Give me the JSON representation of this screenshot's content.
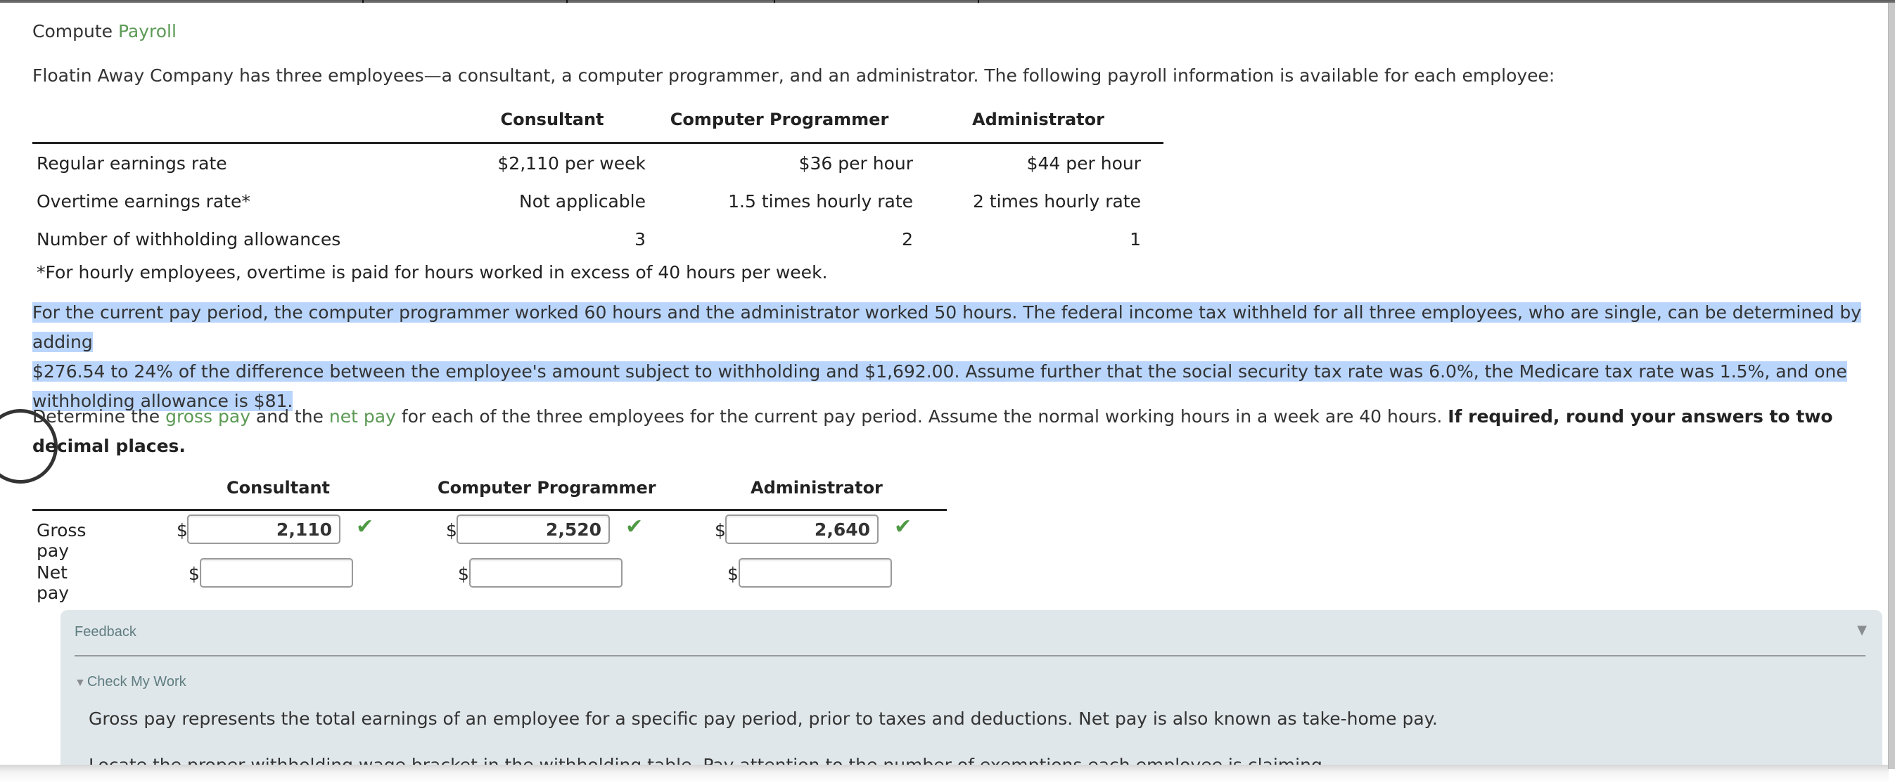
{
  "title": {
    "prefix": "Compute ",
    "link": "Payroll"
  },
  "intro": "Floatin Away Company has three employees—a consultant, a computer programmer, and an administrator. The following payroll information is available for each employee:",
  "info_table": {
    "headers": [
      "",
      "Consultant",
      "Computer Programmer",
      "Administrator"
    ],
    "rows": [
      {
        "label": "Regular earnings rate",
        "values": [
          "$2,110 per week",
          "$36 per hour",
          "$44 per hour"
        ]
      },
      {
        "label": "Overtime earnings rate*",
        "values": [
          "Not applicable",
          "1.5 times hourly rate",
          "2 times hourly rate"
        ]
      },
      {
        "label": "Number of withholding allowances",
        "values": [
          "3",
          "2",
          "1"
        ]
      }
    ],
    "footnote": "*For hourly employees, overtime is paid for hours worked in excess of 40 hours per week."
  },
  "scenario": {
    "line1": "For the current pay period, the computer programmer worked 60 hours and the administrator worked 50 hours. The federal income tax withheld for all three employees, who are single, can be determined by adding",
    "line2": "$276.54 to 24% of the difference between the employee's amount subject to withholding and $1,692.00. Assume further that the social security tax rate was 6.0%, the Medicare tax rate was 1.5%, and one",
    "line3": "withholding allowance is $81."
  },
  "instruction": {
    "t1": "Determine the ",
    "link1": "gross pay",
    "t2": " and the ",
    "link2": "net pay",
    "t3": " for each of the three employees for the current pay period. Assume the normal working hours in a week are 40 hours. ",
    "bold": "If required, round your answers to two decimal places."
  },
  "answer_table": {
    "headers": [
      "Consultant",
      "Computer Programmer",
      "Administrator"
    ],
    "currency": "$",
    "gross_pay": {
      "label": "Gross pay",
      "values": [
        "2,110",
        "2,520",
        "2,640"
      ],
      "status": [
        "correct",
        "correct",
        "correct"
      ]
    },
    "net_pay": {
      "label": "Net pay",
      "values": [
        "",
        "",
        ""
      ]
    },
    "check_glyph": "✔"
  },
  "feedback": {
    "title": "Feedback",
    "toggle_glyph": "▼",
    "check_my_work": "Check My Work",
    "check_my_work_glyph": "▼",
    "p1": "Gross pay represents the total earnings of an employee for a specific pay period, prior to taxes and deductions. Net pay is also known as take-home pay.",
    "p2": "Locate the proper withholding wage bracket in the withholding table. Pay attention to the number of exemptions each employee is claiming."
  },
  "colors": {
    "link_green": "#5c9a55",
    "check_green": "#4f9a45",
    "selection": "#b9d5fb",
    "feedback_bg": "#e0e7ea",
    "feedback_title": "#5f7d80"
  }
}
